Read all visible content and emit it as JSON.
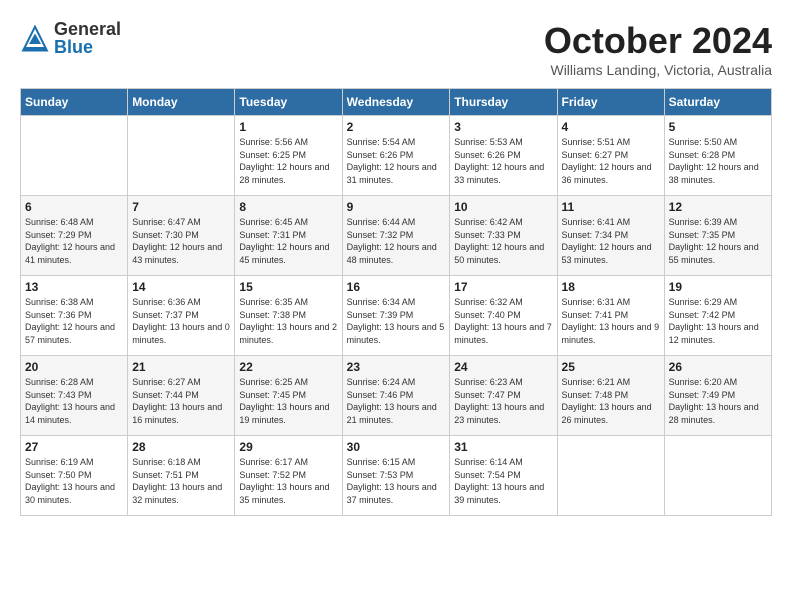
{
  "logo": {
    "general": "General",
    "blue": "Blue"
  },
  "title": "October 2024",
  "subtitle": "Williams Landing, Victoria, Australia",
  "days_of_week": [
    "Sunday",
    "Monday",
    "Tuesday",
    "Wednesday",
    "Thursday",
    "Friday",
    "Saturday"
  ],
  "weeks": [
    [
      {
        "day": "",
        "info": ""
      },
      {
        "day": "",
        "info": ""
      },
      {
        "day": "1",
        "info": "Sunrise: 5:56 AM\nSunset: 6:25 PM\nDaylight: 12 hours and 28 minutes."
      },
      {
        "day": "2",
        "info": "Sunrise: 5:54 AM\nSunset: 6:26 PM\nDaylight: 12 hours and 31 minutes."
      },
      {
        "day": "3",
        "info": "Sunrise: 5:53 AM\nSunset: 6:26 PM\nDaylight: 12 hours and 33 minutes."
      },
      {
        "day": "4",
        "info": "Sunrise: 5:51 AM\nSunset: 6:27 PM\nDaylight: 12 hours and 36 minutes."
      },
      {
        "day": "5",
        "info": "Sunrise: 5:50 AM\nSunset: 6:28 PM\nDaylight: 12 hours and 38 minutes."
      }
    ],
    [
      {
        "day": "6",
        "info": "Sunrise: 6:48 AM\nSunset: 7:29 PM\nDaylight: 12 hours and 41 minutes."
      },
      {
        "day": "7",
        "info": "Sunrise: 6:47 AM\nSunset: 7:30 PM\nDaylight: 12 hours and 43 minutes."
      },
      {
        "day": "8",
        "info": "Sunrise: 6:45 AM\nSunset: 7:31 PM\nDaylight: 12 hours and 45 minutes."
      },
      {
        "day": "9",
        "info": "Sunrise: 6:44 AM\nSunset: 7:32 PM\nDaylight: 12 hours and 48 minutes."
      },
      {
        "day": "10",
        "info": "Sunrise: 6:42 AM\nSunset: 7:33 PM\nDaylight: 12 hours and 50 minutes."
      },
      {
        "day": "11",
        "info": "Sunrise: 6:41 AM\nSunset: 7:34 PM\nDaylight: 12 hours and 53 minutes."
      },
      {
        "day": "12",
        "info": "Sunrise: 6:39 AM\nSunset: 7:35 PM\nDaylight: 12 hours and 55 minutes."
      }
    ],
    [
      {
        "day": "13",
        "info": "Sunrise: 6:38 AM\nSunset: 7:36 PM\nDaylight: 12 hours and 57 minutes."
      },
      {
        "day": "14",
        "info": "Sunrise: 6:36 AM\nSunset: 7:37 PM\nDaylight: 13 hours and 0 minutes."
      },
      {
        "day": "15",
        "info": "Sunrise: 6:35 AM\nSunset: 7:38 PM\nDaylight: 13 hours and 2 minutes."
      },
      {
        "day": "16",
        "info": "Sunrise: 6:34 AM\nSunset: 7:39 PM\nDaylight: 13 hours and 5 minutes."
      },
      {
        "day": "17",
        "info": "Sunrise: 6:32 AM\nSunset: 7:40 PM\nDaylight: 13 hours and 7 minutes."
      },
      {
        "day": "18",
        "info": "Sunrise: 6:31 AM\nSunset: 7:41 PM\nDaylight: 13 hours and 9 minutes."
      },
      {
        "day": "19",
        "info": "Sunrise: 6:29 AM\nSunset: 7:42 PM\nDaylight: 13 hours and 12 minutes."
      }
    ],
    [
      {
        "day": "20",
        "info": "Sunrise: 6:28 AM\nSunset: 7:43 PM\nDaylight: 13 hours and 14 minutes."
      },
      {
        "day": "21",
        "info": "Sunrise: 6:27 AM\nSunset: 7:44 PM\nDaylight: 13 hours and 16 minutes."
      },
      {
        "day": "22",
        "info": "Sunrise: 6:25 AM\nSunset: 7:45 PM\nDaylight: 13 hours and 19 minutes."
      },
      {
        "day": "23",
        "info": "Sunrise: 6:24 AM\nSunset: 7:46 PM\nDaylight: 13 hours and 21 minutes."
      },
      {
        "day": "24",
        "info": "Sunrise: 6:23 AM\nSunset: 7:47 PM\nDaylight: 13 hours and 23 minutes."
      },
      {
        "day": "25",
        "info": "Sunrise: 6:21 AM\nSunset: 7:48 PM\nDaylight: 13 hours and 26 minutes."
      },
      {
        "day": "26",
        "info": "Sunrise: 6:20 AM\nSunset: 7:49 PM\nDaylight: 13 hours and 28 minutes."
      }
    ],
    [
      {
        "day": "27",
        "info": "Sunrise: 6:19 AM\nSunset: 7:50 PM\nDaylight: 13 hours and 30 minutes."
      },
      {
        "day": "28",
        "info": "Sunrise: 6:18 AM\nSunset: 7:51 PM\nDaylight: 13 hours and 32 minutes."
      },
      {
        "day": "29",
        "info": "Sunrise: 6:17 AM\nSunset: 7:52 PM\nDaylight: 13 hours and 35 minutes."
      },
      {
        "day": "30",
        "info": "Sunrise: 6:15 AM\nSunset: 7:53 PM\nDaylight: 13 hours and 37 minutes."
      },
      {
        "day": "31",
        "info": "Sunrise: 6:14 AM\nSunset: 7:54 PM\nDaylight: 13 hours and 39 minutes."
      },
      {
        "day": "",
        "info": ""
      },
      {
        "day": "",
        "info": ""
      }
    ]
  ]
}
